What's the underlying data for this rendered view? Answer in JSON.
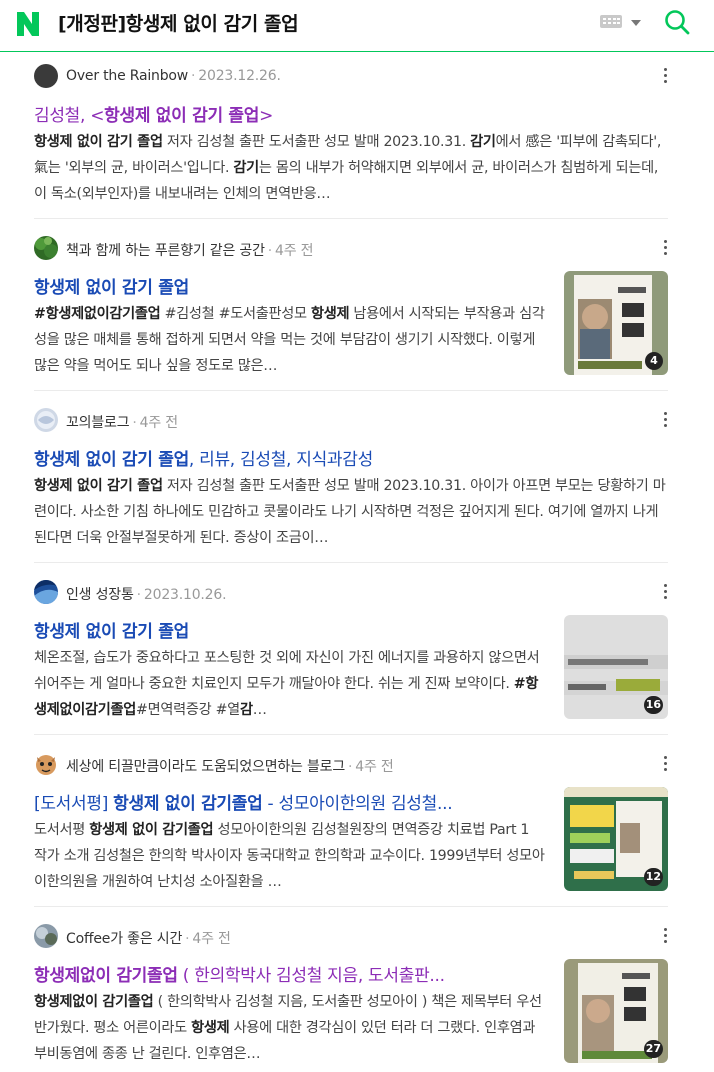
{
  "header": {
    "logo": "N",
    "query": "[개정판]항생제 없이 감기 졸업",
    "icons": [
      "naver-logo-icon",
      "keyboard-icon",
      "chevron-down-icon",
      "search-icon"
    ],
    "brand_color": "#03c75a"
  },
  "results": [
    {
      "author": "Over the Rainbow",
      "date": "2023.12.26.",
      "title_parts": [
        {
          "text": "김성철, <",
          "bold": false
        },
        {
          "text": "항생제 없이 감기 졸업",
          "bold": true
        },
        {
          "text": ">",
          "bold": false
        }
      ],
      "title_color": "purple",
      "desc_parts": [
        {
          "text": "항생제 없이 감기 졸업",
          "bold": true
        },
        {
          "text": " 저자 김성철 출판 도서출판 성모 발매 2023.10.31. ",
          "bold": false
        },
        {
          "text": "감기",
          "bold": true
        },
        {
          "text": "에서 感은 '피부에 감촉되다', 氣는 '외부의 균, 바이러스'입니다. ",
          "bold": false
        },
        {
          "text": "감기",
          "bold": true
        },
        {
          "text": "는 몸의 내부가 허약해지면 외부에서 균, 바이러스가 침범하게 되는데, 이 독소(외부인자)를 내보내려는 인체의 면역반응…",
          "bold": false
        }
      ],
      "thumb_count": ""
    },
    {
      "author": "책과 함께 하는 푸른향기 같은 공간",
      "date": "4주 전",
      "title_parts": [
        {
          "text": "항생제 없이 감기 졸업",
          "bold": true
        }
      ],
      "title_color": "blue",
      "desc_parts": [
        {
          "text": "#항생제없이감기졸업",
          "bold": true
        },
        {
          "text": " #김성철 #도서출판성모 ",
          "bold": false
        },
        {
          "text": "항생제",
          "bold": true
        },
        {
          "text": " 남용에서 시작되는 부작용과 심각성을 많은 매체를 통해 접하게 되면서 약을 먹는 것에 부담감이 생기기 시작했다. 이렇게 많은 약을 먹어도 되나 싶을 정도로 많은…",
          "bold": false
        }
      ],
      "thumb_count": "4"
    },
    {
      "author": "꼬의블로그",
      "date": "4주 전",
      "title_parts": [
        {
          "text": "항생제 없이 감기 졸업",
          "bold": true
        },
        {
          "text": ", 리뷰, 김성철, 지식과감성",
          "bold": false
        }
      ],
      "title_color": "blue",
      "desc_parts": [
        {
          "text": "항생제 없이 감기 졸업",
          "bold": true
        },
        {
          "text": " 저자 김성철 출판 도서출판 성모 발매 2023.10.31. 아이가 아프면 부모는 당황하기 마련이다. 사소한 기침 하나에도 민감하고 콧물이라도 나기 시작하면 걱정은 깊어지게 된다. 여기에 열까지 나게 된다면 더욱 안절부절못하게 된다. 증상이 조금이…",
          "bold": false
        }
      ],
      "thumb_count": ""
    },
    {
      "author": "인생 성장통",
      "date": "2023.10.26.",
      "title_parts": [
        {
          "text": "항생제 없이 감기 졸업",
          "bold": true
        }
      ],
      "title_color": "blue",
      "desc_parts": [
        {
          "text": "체온조절, 습도가 중요하다고 포스팅한 것 외에 자신이 가진 에너지를 과용하지 않으면서 쉬어주는 게 얼마나 중요한 치료인지 모두가 깨달아야 한다. 쉬는 게 진짜 보약이다. ",
          "bold": false
        },
        {
          "text": "#항생제없이감기졸업",
          "bold": true
        },
        {
          "text": "#면역력증강 #열",
          "bold": false
        },
        {
          "text": "감",
          "bold": true
        },
        {
          "text": "…",
          "bold": false
        }
      ],
      "thumb_count": "16"
    },
    {
      "author": "세상에 티끌만큼이라도 도움되었으면하는 블로그",
      "date": "4주 전",
      "title_parts": [
        {
          "text": "[도서서평] ",
          "bold": false
        },
        {
          "text": "항생제 없이 감기졸업",
          "bold": true
        },
        {
          "text": " - 성모아이한의원 김성철...",
          "bold": false
        }
      ],
      "title_color": "blue",
      "desc_parts": [
        {
          "text": "도서서평 ",
          "bold": false
        },
        {
          "text": "항생제 없이 감기졸업",
          "bold": true
        },
        {
          "text": " 성모아이한의원 김성철원장의 면역증강 치료법 Part 1 작가 소개 김성철은 한의학 박사이자 동국대학교 한의학과 교수이다. 1999년부터 성모아이한의원을 개원하여 난치성 소아질환을 …",
          "bold": false
        }
      ],
      "thumb_count": "12"
    },
    {
      "author": "Coffee가 좋은 시간",
      "date": "4주 전",
      "title_parts": [
        {
          "text": "항생제없이 감기졸업",
          "bold": true
        },
        {
          "text": " ( 한의학박사 김성철 지음, 도서출판...",
          "bold": false
        }
      ],
      "title_color": "purple",
      "desc_parts": [
        {
          "text": "항생제없이 감기졸업",
          "bold": true
        },
        {
          "text": " ( 한의학박사 김성철 지음, 도서출판 성모아이 ) 책은 제목부터 우선 반가웠다. 평소 어른이라도 ",
          "bold": false
        },
        {
          "text": "항생제",
          "bold": true
        },
        {
          "text": " 사용에 대한 경각심이 있던 터라 더 그랬다. 인후염과 부비동염에 종종 난 걸린다. 인후염은…",
          "bold": false
        }
      ],
      "thumb_count": "27"
    }
  ]
}
